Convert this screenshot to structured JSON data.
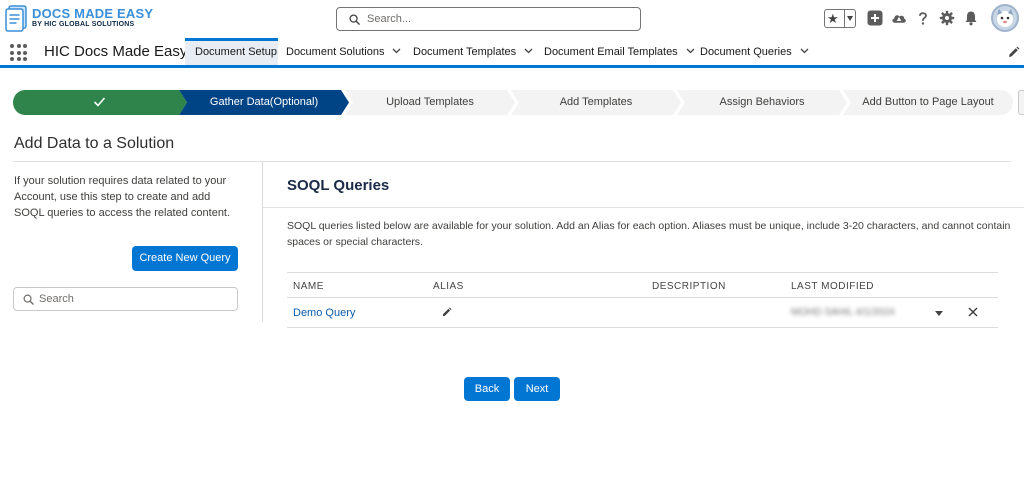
{
  "header": {
    "logo_title": "DOCS MADE EASY",
    "logo_subtitle": "BY HIC GLOBAL SOLUTIONS",
    "search_placeholder": "Search..."
  },
  "nav": {
    "app_name": "HIC Docs Made Easy",
    "tabs": [
      {
        "label": "Document Setup",
        "active": true,
        "has_menu": false
      },
      {
        "label": "Document Solutions",
        "active": false,
        "has_menu": true
      },
      {
        "label": "Document Templates",
        "active": false,
        "has_menu": true
      },
      {
        "label": "Document Email Templates",
        "active": false,
        "has_menu": true
      },
      {
        "label": "Document Queries",
        "active": false,
        "has_menu": true
      }
    ]
  },
  "path": {
    "steps": [
      {
        "label": "",
        "state": "complete"
      },
      {
        "label": "Gather Data(Optional)",
        "state": "current"
      },
      {
        "label": "Upload Templates",
        "state": "incomplete"
      },
      {
        "label": "Add Templates",
        "state": "incomplete"
      },
      {
        "label": "Assign Behaviors",
        "state": "incomplete"
      },
      {
        "label": "Add Button to Page Layout",
        "state": "incomplete"
      }
    ]
  },
  "page": {
    "title": "Add Data to a Solution"
  },
  "left": {
    "description": "If your solution requires data related to your Account, use this step to create and add SOQL queries to access the related content.",
    "create_button": "Create New Query",
    "search_placeholder": "Search"
  },
  "main": {
    "section_title": "SOQL Queries",
    "info": "SOQL queries listed below are available for your solution. Add an Alias for each option. Aliases must be unique, include 3-20 characters, and cannot contain spaces or special characters.",
    "columns": [
      "NAME",
      "ALIAS",
      "DESCRIPTION",
      "LAST MODIFIED"
    ],
    "rows": [
      {
        "name": "Demo Query",
        "alias": "",
        "description": "",
        "last_modified": "MOHD SAHIL  4/1/2024"
      }
    ]
  },
  "footer": {
    "back": "Back",
    "next": "Next"
  },
  "colors": {
    "brand_blue": "#0176d3",
    "complete_green": "#2e844a",
    "current_navy": "#014486",
    "incomplete_gray": "#f3f3f3"
  }
}
